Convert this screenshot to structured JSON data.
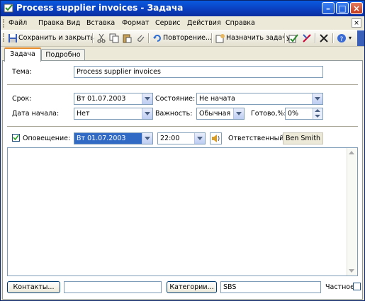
{
  "window": {
    "title": "Process supplier invoices - Задача"
  },
  "menu": {
    "items": [
      "Файл",
      "Правка",
      "Вид",
      "Вставка",
      "Формат",
      "Сервис",
      "Действия",
      "Справка"
    ]
  },
  "toolbar": {
    "save_close": "Сохранить и закрыть",
    "recurrence": "Повторение...",
    "assign": "Назначить задачу"
  },
  "tabs": [
    "Задача",
    "Подробно"
  ],
  "task": {
    "subject_label": "Тема:",
    "subject_value": "Process supplier invoices",
    "due_label": "Срок:",
    "due_value": "Вт 01.07.2003",
    "start_label": "Дата начала:",
    "start_value": "Нет",
    "status_label": "Состояние:",
    "status_value": "Не начата",
    "priority_label": "Важность:",
    "priority_value": "Обычная",
    "complete_label": "Готово,%:",
    "complete_value": "0%",
    "reminder_label": "Оповещение:",
    "reminder_date": "Вт 01.07.2003",
    "reminder_time": "22:00",
    "owner_label": "Ответственный:",
    "owner_value": "Ben Smith"
  },
  "footer": {
    "contacts": "Контакты...",
    "categories": "Категории...",
    "category_value": "SBS",
    "private_label": "Частное"
  },
  "colors": {
    "title_bar": "#0a3dbd",
    "selection": "#316ac5",
    "tab_accent": "#e68b2c"
  }
}
